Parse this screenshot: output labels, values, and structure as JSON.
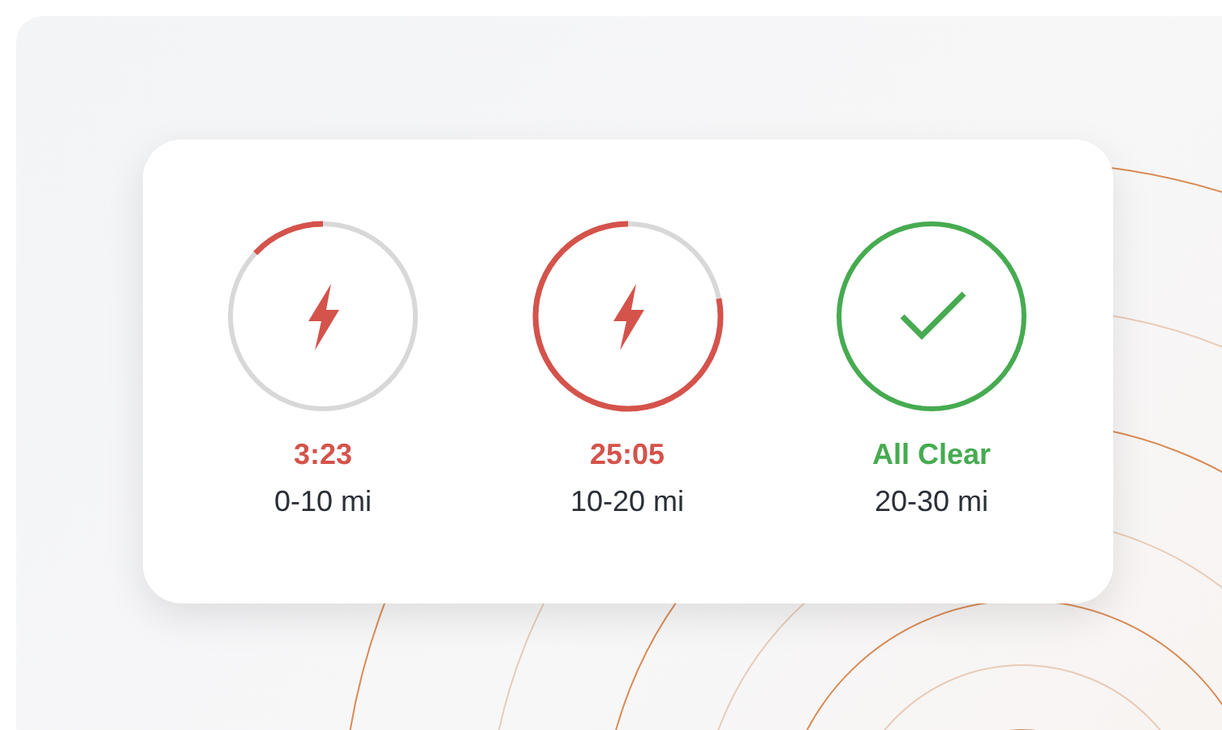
{
  "zones": [
    {
      "kind": "countdown",
      "level": 0.13,
      "status": "3:23",
      "range": "0-10 mi"
    },
    {
      "kind": "countdown",
      "level": 0.78,
      "status": "25:05",
      "range": "10-20 mi"
    },
    {
      "kind": "clear",
      "status": "All Clear",
      "range": "20-30 mi"
    }
  ]
}
